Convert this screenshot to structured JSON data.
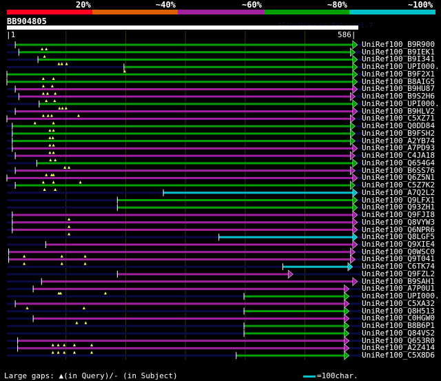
{
  "header": {
    "percent_labels": [
      "20%",
      "~40%",
      "~60%",
      "~80%",
      "~100%"
    ],
    "colors": [
      "#ff0022",
      "#e06000",
      "#a020a0",
      "#00a000",
      "#00c0c8"
    ]
  },
  "watermark": "AlignView.pm Beta rel.7",
  "query": {
    "name": "BB904805",
    "start_label": "|1",
    "end_label": "586|",
    "length": 586
  },
  "grid_every": 100,
  "colors": {
    "red": "#ff0022",
    "orange": "#e06000",
    "purple": "#a020a0",
    "green": "#00a000",
    "cyan": "#00c0c8",
    "subject_bg": "#0a0a44",
    "gap_marker": "#ffff66",
    "grid": "#333311"
  },
  "hits": [
    {
      "label": "UniRef100_B9R900",
      "color": "green",
      "start": 15,
      "end": 580,
      "gaps": [
        60,
        67
      ]
    },
    {
      "label": "UniRef100_B9IEK1",
      "color": "green",
      "start": 21,
      "end": 576,
      "gaps": [
        64
      ]
    },
    {
      "label": "UniRef100_B9I341",
      "color": "green",
      "start": 53,
      "end": 580,
      "gaps": [
        88,
        93,
        101
      ]
    },
    {
      "label": "UniRef100_UPI000..",
      "color": "green",
      "start": 197,
      "end": 580,
      "gaps": [
        198
      ]
    },
    {
      "label": "UniRef100_B9F2X1",
      "color": "green",
      "start": 1,
      "end": 580,
      "gaps": [
        62,
        79
      ]
    },
    {
      "label": "UniRef100_B8AIG5",
      "color": "green",
      "start": 1,
      "end": 580,
      "gaps": [
        62,
        77
      ]
    },
    {
      "label": "UniRef100_B9HU87",
      "color": "purple",
      "start": 15,
      "end": 580,
      "gaps": [
        62,
        69,
        82
      ]
    },
    {
      "label": "UniRef100_B9S2H6",
      "color": "purple",
      "start": 21,
      "end": 576,
      "gaps": [
        67,
        81
      ]
    },
    {
      "label": "UniRef100_UPI000..",
      "color": "green",
      "start": 55,
      "end": 580,
      "gaps": [
        89,
        94,
        100
      ]
    },
    {
      "label": "UniRef100_B9HLV2",
      "color": "purple",
      "start": 15,
      "end": 580,
      "gaps": [
        62,
        70,
        76,
        121
      ]
    },
    {
      "label": "UniRef100_C5XZ71",
      "color": "purple",
      "start": 1,
      "end": 576,
      "gaps": [
        48,
        79
      ]
    },
    {
      "label": "UniRef100_Q0DD84",
      "color": "green",
      "start": 10,
      "end": 576,
      "gaps": [
        73,
        79
      ]
    },
    {
      "label": "UniRef100_B9FSH2",
      "color": "green",
      "start": 10,
      "end": 576,
      "gaps": [
        73,
        78
      ]
    },
    {
      "label": "UniRef100_A2YB74",
      "color": "green",
      "start": 10,
      "end": 576,
      "gaps": [
        73,
        79
      ]
    },
    {
      "label": "UniRef100_A7PD93",
      "color": "purple",
      "start": 10,
      "end": 580,
      "gaps": [
        73,
        79
      ]
    },
    {
      "label": "UniRef100_C4JA18",
      "color": "purple",
      "start": 15,
      "end": 576,
      "gaps": [
        74,
        82
      ]
    },
    {
      "label": "UniRef100_Q654G4",
      "color": "green",
      "start": 51,
      "end": 580,
      "gaps": [
        98,
        105
      ]
    },
    {
      "label": "UniRef100_B6SS76",
      "color": "purple",
      "start": 15,
      "end": 576,
      "gaps": [
        67,
        76,
        79
      ]
    },
    {
      "label": "UniRef100_Q6Z5N1",
      "color": "purple",
      "start": 1,
      "end": 580,
      "gaps": [
        62,
        79,
        124
      ]
    },
    {
      "label": "UniRef100_C5Z7K2",
      "color": "green",
      "start": 15,
      "end": 576,
      "gaps": [
        64,
        82
      ]
    },
    {
      "label": "UniRef100_A7Q2L2",
      "color": "cyan",
      "start": 263,
      "end": 580,
      "gaps": []
    },
    {
      "label": "UniRef100_Q9LFX1",
      "color": "green",
      "start": 186,
      "end": 580,
      "gaps": []
    },
    {
      "label": "UniRef100_Q93ZH1",
      "color": "green",
      "start": 186,
      "end": 580,
      "gaps": []
    },
    {
      "label": "UniRef100_Q9FJI8",
      "color": "purple",
      "start": 10,
      "end": 580,
      "gaps": [
        105
      ]
    },
    {
      "label": "UniRef100_Q8VYW3",
      "color": "purple",
      "start": 10,
      "end": 580,
      "gaps": [
        105
      ]
    },
    {
      "label": "UniRef100_Q6NPR6",
      "color": "purple",
      "start": 10,
      "end": 580,
      "gaps": [
        105
      ]
    },
    {
      "label": "UniRef100_Q8LGF5",
      "color": "cyan",
      "start": 356,
      "end": 580,
      "gaps": []
    },
    {
      "label": "UniRef100_Q9XIE4",
      "color": "purple",
      "start": 66,
      "end": 580,
      "gaps": []
    },
    {
      "label": "UniRef100_Q0WSC0",
      "color": "purple",
      "start": 4,
      "end": 576,
      "gaps": [
        30,
        93,
        132
      ]
    },
    {
      "label": "UniRef100_Q9T041",
      "color": "purple",
      "start": 4,
      "end": 576,
      "gaps": [
        30,
        93,
        132
      ]
    },
    {
      "label": "UniRef100_C6TK74",
      "color": "cyan",
      "start": 463,
      "end": 572,
      "gaps": []
    },
    {
      "label": "UniRef100_Q9FZL2",
      "color": "purple",
      "start": 186,
      "end": 472,
      "gaps": []
    },
    {
      "label": "UniRef100_B9SAH1",
      "color": "purple",
      "start": 59,
      "end": 580,
      "gaps": []
    },
    {
      "label": "UniRef100_A7P0U1",
      "color": "purple",
      "start": 45,
      "end": 566,
      "gaps": [
        88,
        91,
        166
      ]
    },
    {
      "label": "UniRef100_UPI000..",
      "color": "green",
      "start": 398,
      "end": 566,
      "gaps": []
    },
    {
      "label": "UniRef100_C5XA32",
      "color": "purple",
      "start": 15,
      "end": 566,
      "gaps": [
        35,
        130
      ]
    },
    {
      "label": "UniRef100_Q8H513",
      "color": "green",
      "start": 398,
      "end": 566,
      "gaps": []
    },
    {
      "label": "UniRef100_C0HGW0",
      "color": "purple",
      "start": 45,
      "end": 566,
      "gaps": [
        118,
        133
      ]
    },
    {
      "label": "UniRef100_B8B6P1",
      "color": "green",
      "start": 398,
      "end": 566,
      "gaps": []
    },
    {
      "label": "UniRef100_Q84VS2",
      "color": "green",
      "start": 398,
      "end": 566,
      "gaps": []
    },
    {
      "label": "UniRef100_Q653R0",
      "color": "purple",
      "start": 19,
      "end": 566,
      "gaps": [
        78,
        87,
        97,
        114,
        143
      ]
    },
    {
      "label": "UniRef100_A2Z414",
      "color": "purple",
      "start": 19,
      "end": 566,
      "gaps": [
        78,
        87,
        97,
        114,
        143
      ]
    },
    {
      "label": "UniRef100_C5X8D6",
      "color": "green",
      "start": 385,
      "end": 566,
      "gaps": []
    }
  ],
  "legend": {
    "text": "Large gaps: ▲(in Query)/- (in Subject)",
    "scale_text": "=100char."
  }
}
